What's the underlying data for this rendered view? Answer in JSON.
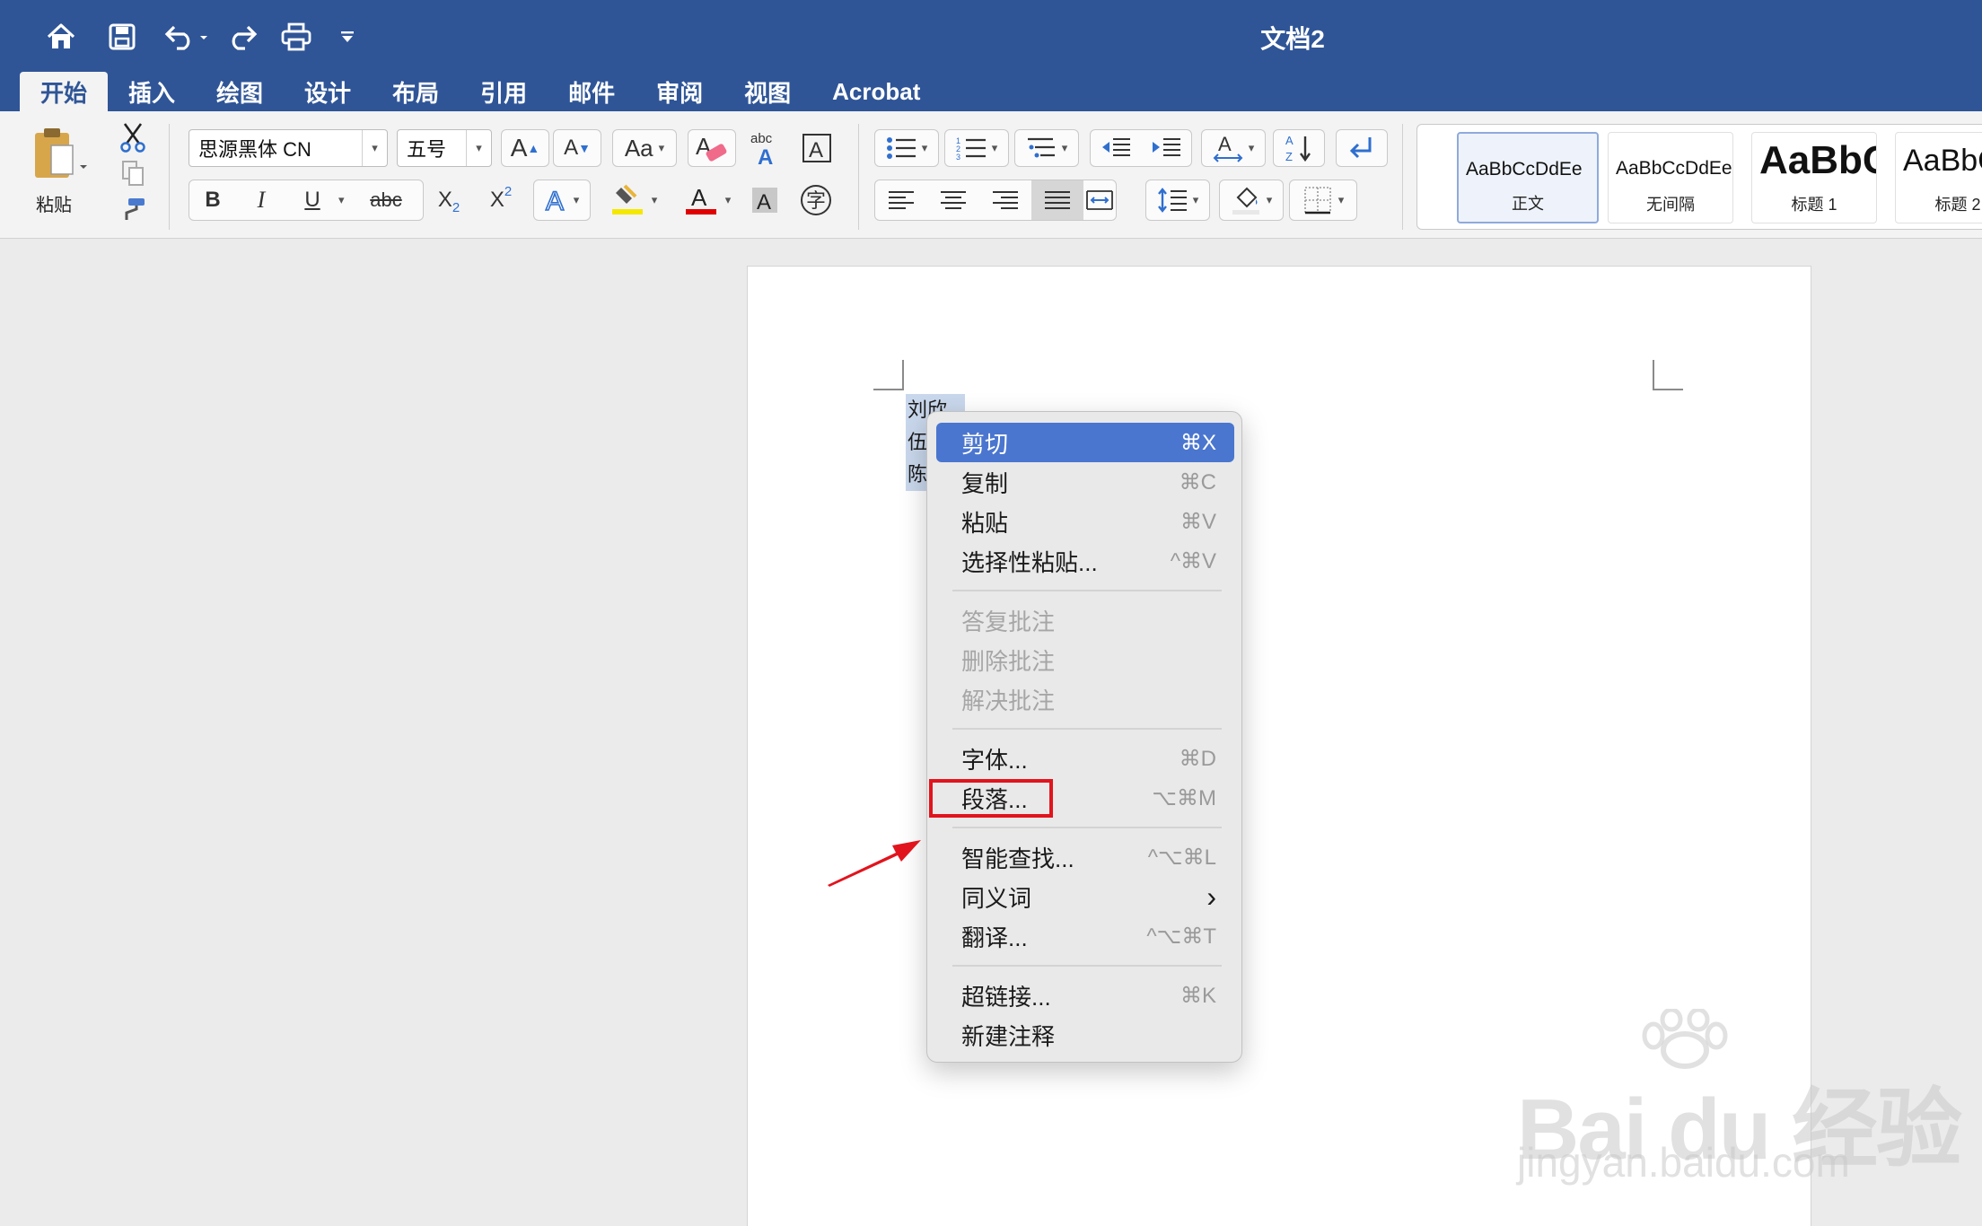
{
  "window": {
    "title": "文档2"
  },
  "tabs": [
    "开始",
    "插入",
    "绘图",
    "设计",
    "布局",
    "引用",
    "邮件",
    "审阅",
    "视图",
    "Acrobat"
  ],
  "active_tab": "开始",
  "ribbon": {
    "paste_label": "粘贴",
    "font_name": "思源黑体 CN",
    "font_size": "五号",
    "bold": "B",
    "italic": "I",
    "underline": "U",
    "strikethrough": "abc",
    "font_color_hex": "#e00000",
    "highlight_color_hex": "#f5e800",
    "styles": [
      {
        "preview": "AaBbCcDdEe",
        "name": "正文"
      },
      {
        "preview": "AaBbCcDdEe",
        "name": "无间隔"
      },
      {
        "preview": "AaBbC",
        "name": "标题 1"
      },
      {
        "preview": "AaBbC",
        "name": "标题 2"
      }
    ]
  },
  "document": {
    "lines": [
      "刘欣",
      "伍",
      "陈"
    ]
  },
  "context_menu": {
    "items": [
      {
        "label": "剪切",
        "shortcut": "⌘X"
      },
      {
        "label": "复制",
        "shortcut": "⌘C"
      },
      {
        "label": "粘贴",
        "shortcut": "⌘V"
      },
      {
        "label": "选择性粘贴...",
        "shortcut": "^⌘V"
      },
      {
        "label": "答复批注",
        "shortcut": ""
      },
      {
        "label": "删除批注",
        "shortcut": ""
      },
      {
        "label": "解决批注",
        "shortcut": ""
      },
      {
        "label": "字体...",
        "shortcut": "⌘D"
      },
      {
        "label": "段落...",
        "shortcut": "⌥⌘M"
      },
      {
        "label": "智能查找...",
        "shortcut": "^⌥⌘L"
      },
      {
        "label": "同义词",
        "shortcut": "›"
      },
      {
        "label": "翻译...",
        "shortcut": "^⌥⌘T"
      },
      {
        "label": "超链接...",
        "shortcut": "⌘K"
      },
      {
        "label": "新建注释",
        "shortcut": ""
      }
    ],
    "highlighted": "剪切",
    "annotated": "段落...",
    "annotation_color": "#e1141d"
  },
  "watermark": {
    "logo": "Bai du 经验",
    "url": "jingyan.baidu.com"
  }
}
